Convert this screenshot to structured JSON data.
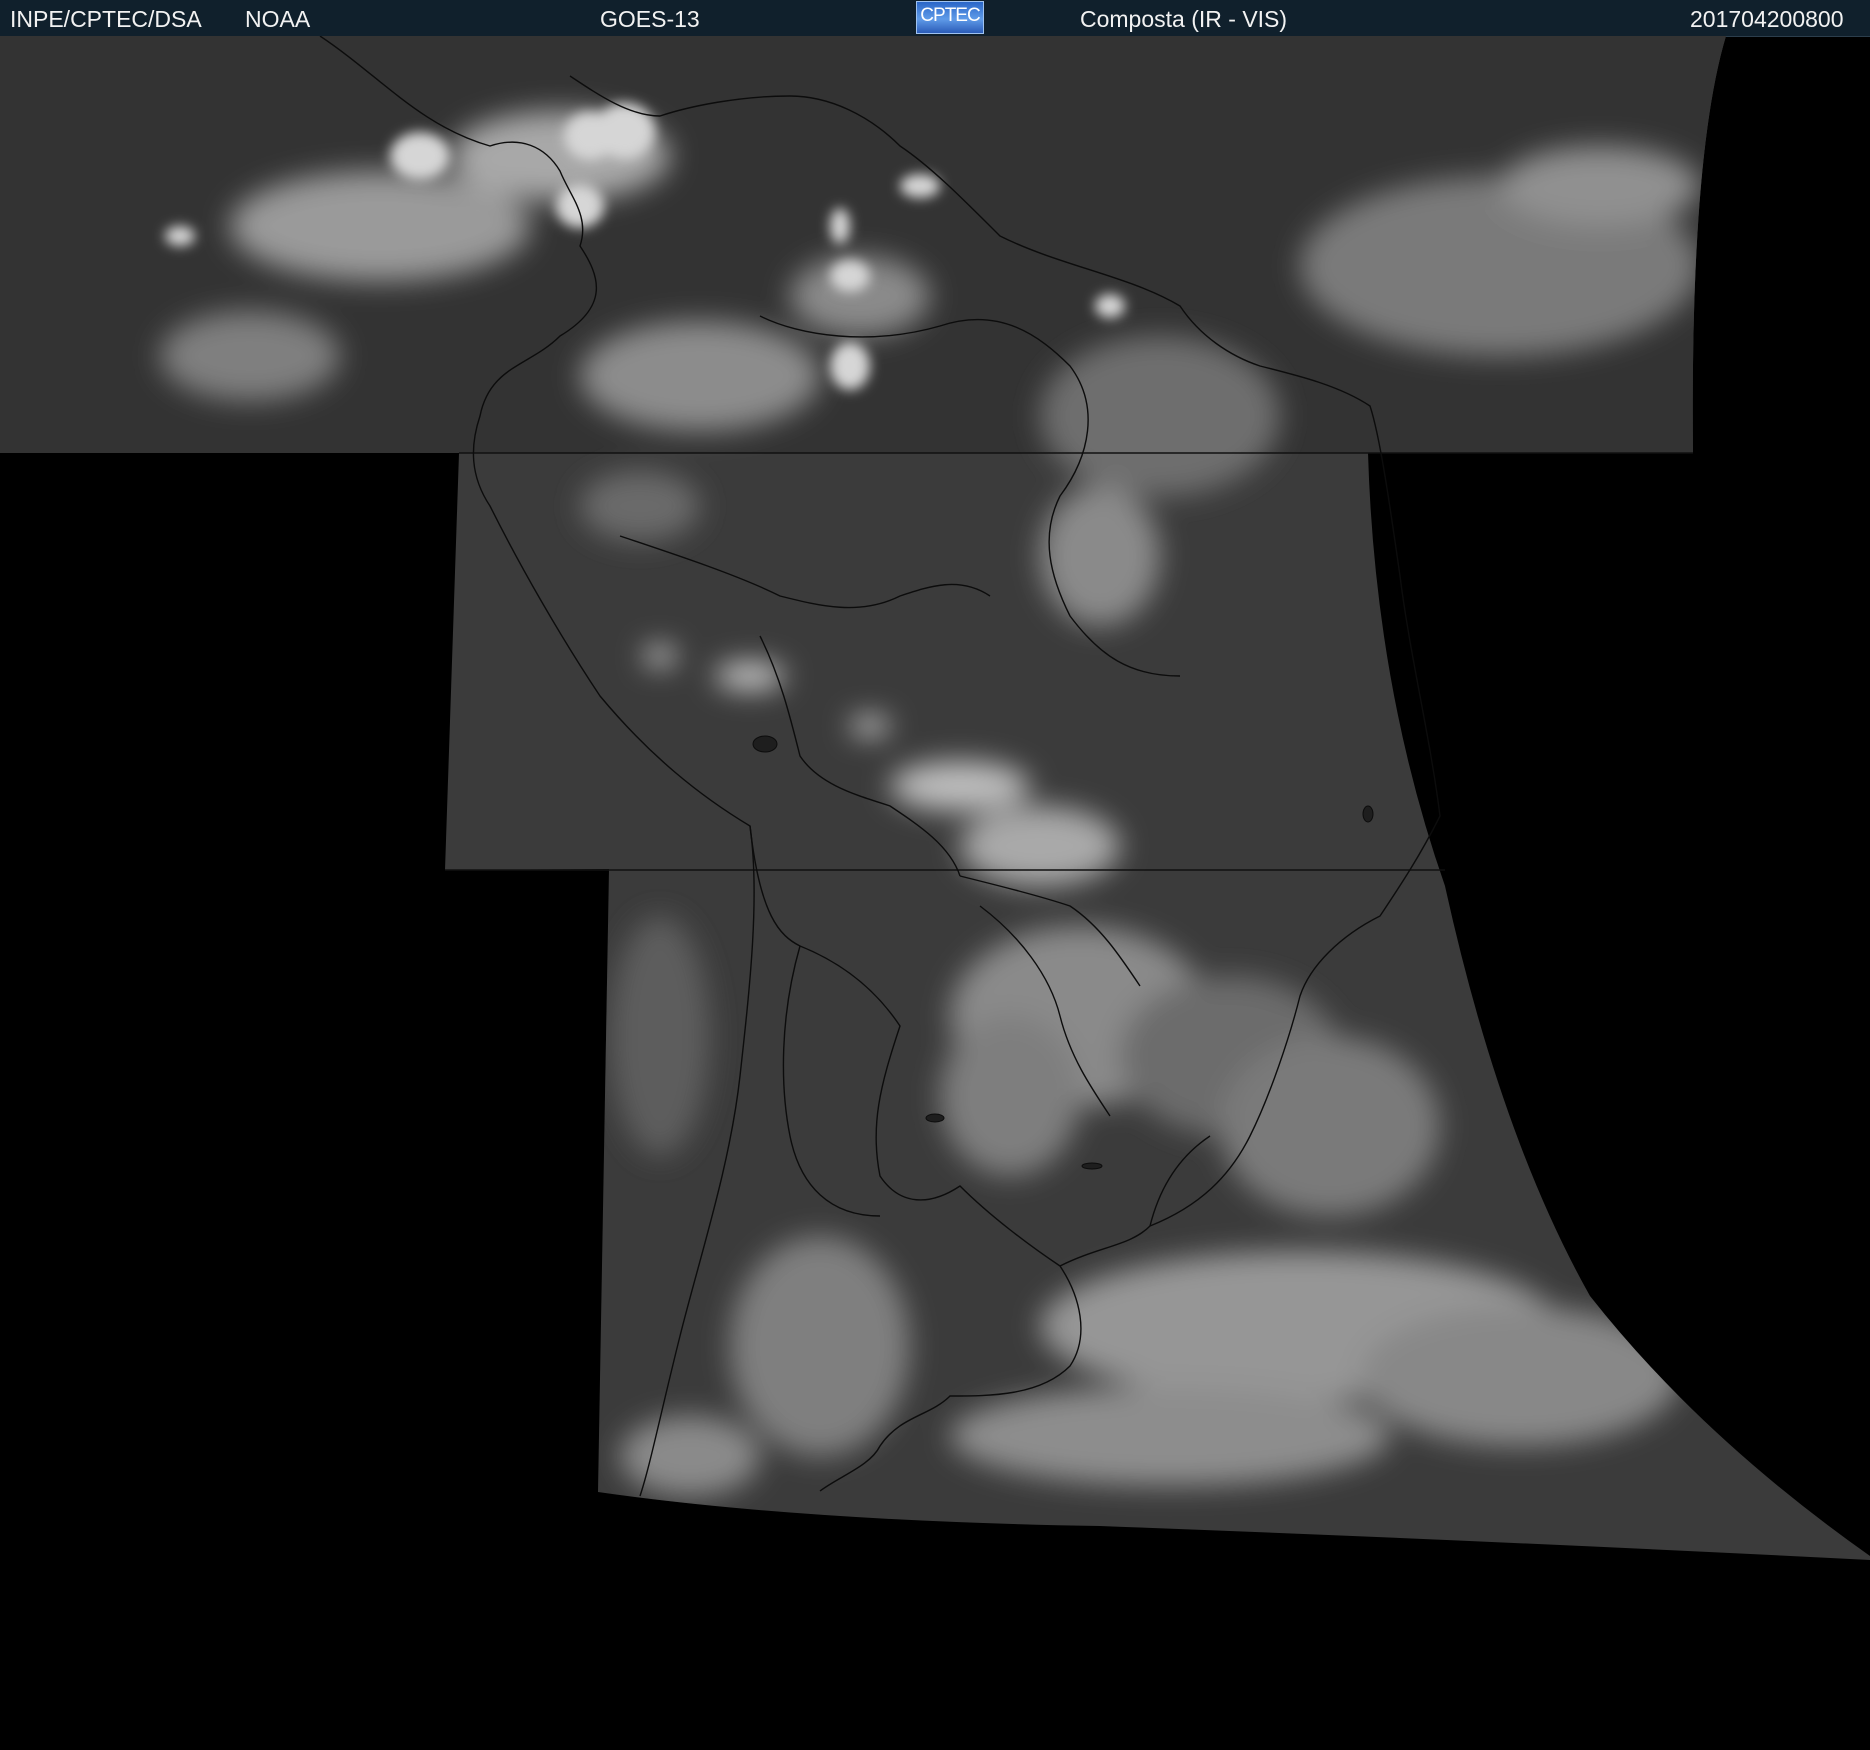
{
  "header": {
    "agency": "INPE/CPTEC/DSA",
    "source": "NOAA",
    "satellite": "GOES-13",
    "logo_text": "CPTEC",
    "product": "Composta (IR - VIS)",
    "timestamp": "201704200800"
  },
  "colors": {
    "header_bg": "#10202c",
    "header_text": "#f2f2f2",
    "background": "#000000",
    "logo": "#3a7bd5"
  }
}
